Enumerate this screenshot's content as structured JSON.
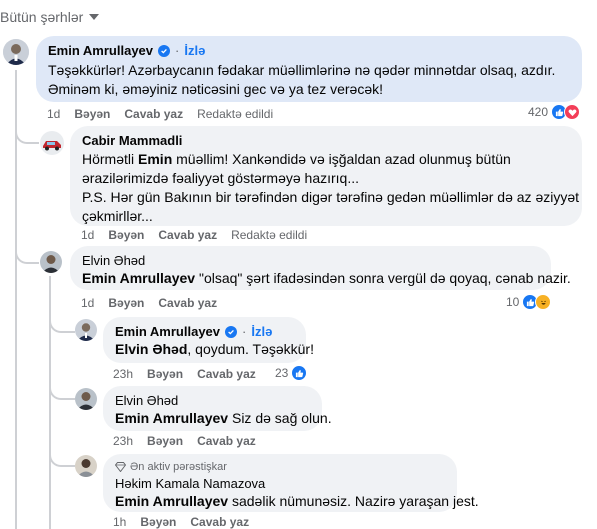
{
  "sort_label": "Bütün şərhlər",
  "comments": [
    {
      "author": "Emin Amrullayev",
      "follow": "İzlə",
      "lines": [
        "Təşəkkürlər! Azərbaycanın fədakar müəllimlərinə nə qədər minnətdar olsaq, azdır.",
        "Əminəm ki, əməyiniz nəticəsini gec və ya tez verəcək!"
      ],
      "time": "1d",
      "like": "Bəyən",
      "reply": "Cavab yaz",
      "edited": "Redaktə edildi",
      "reaction_count": "420"
    },
    {
      "author": "Cabir Mammadli",
      "line1_prefix": "Hörmətli ",
      "line1_bold": "Emin",
      "line1_suffix": " müəllim! Xankəndidə və işğaldan azad olunmuş bütün",
      "line2": "ərazilərimizdə fəaliyyət göstərməyə hazırıq...",
      "line3": "P.S. Hər gün Bakının bir tərəfindən digər tərəfinə gedən müəllimlər də az əziyyət",
      "line4": "çəkmirllər...",
      "time": "1d",
      "like": "Bəyən",
      "reply": "Cavab yaz",
      "edited": "Redaktə edildi"
    },
    {
      "author": "Elvin Əhəd",
      "mention": "Emin Amrullayev",
      "text": " \"olsaq\" şərt ifadəsindən sonra vergül də qoyaq, cənab nazir.",
      "time": "1d",
      "like": "Bəyən",
      "reply": "Cavab yaz",
      "reaction_count": "10"
    },
    {
      "author": "Emin Amrullayev",
      "follow": "İzlə",
      "mention": "Elvin Əhəd",
      "text": ", qoydum. Təşəkkür!",
      "time": "23h",
      "like": "Bəyən",
      "reply": "Cavab yaz",
      "reaction_count": "23"
    },
    {
      "author": "Elvin Əhəd",
      "mention": "Emin Amrullayev",
      "text": " Siz də sağ olun.",
      "time": "23h",
      "like": "Bəyən",
      "reply": "Cavab yaz"
    },
    {
      "badge": "Ən aktiv pərəstişkar",
      "author": "Həkim Kamala Namazova",
      "mention": "Emin Amrullayev",
      "text": " sadəlik nümunəsiz. Nazirə yaraşan jest.",
      "time": "1h",
      "like": "Bəyən",
      "reply": "Cavab yaz"
    }
  ]
}
